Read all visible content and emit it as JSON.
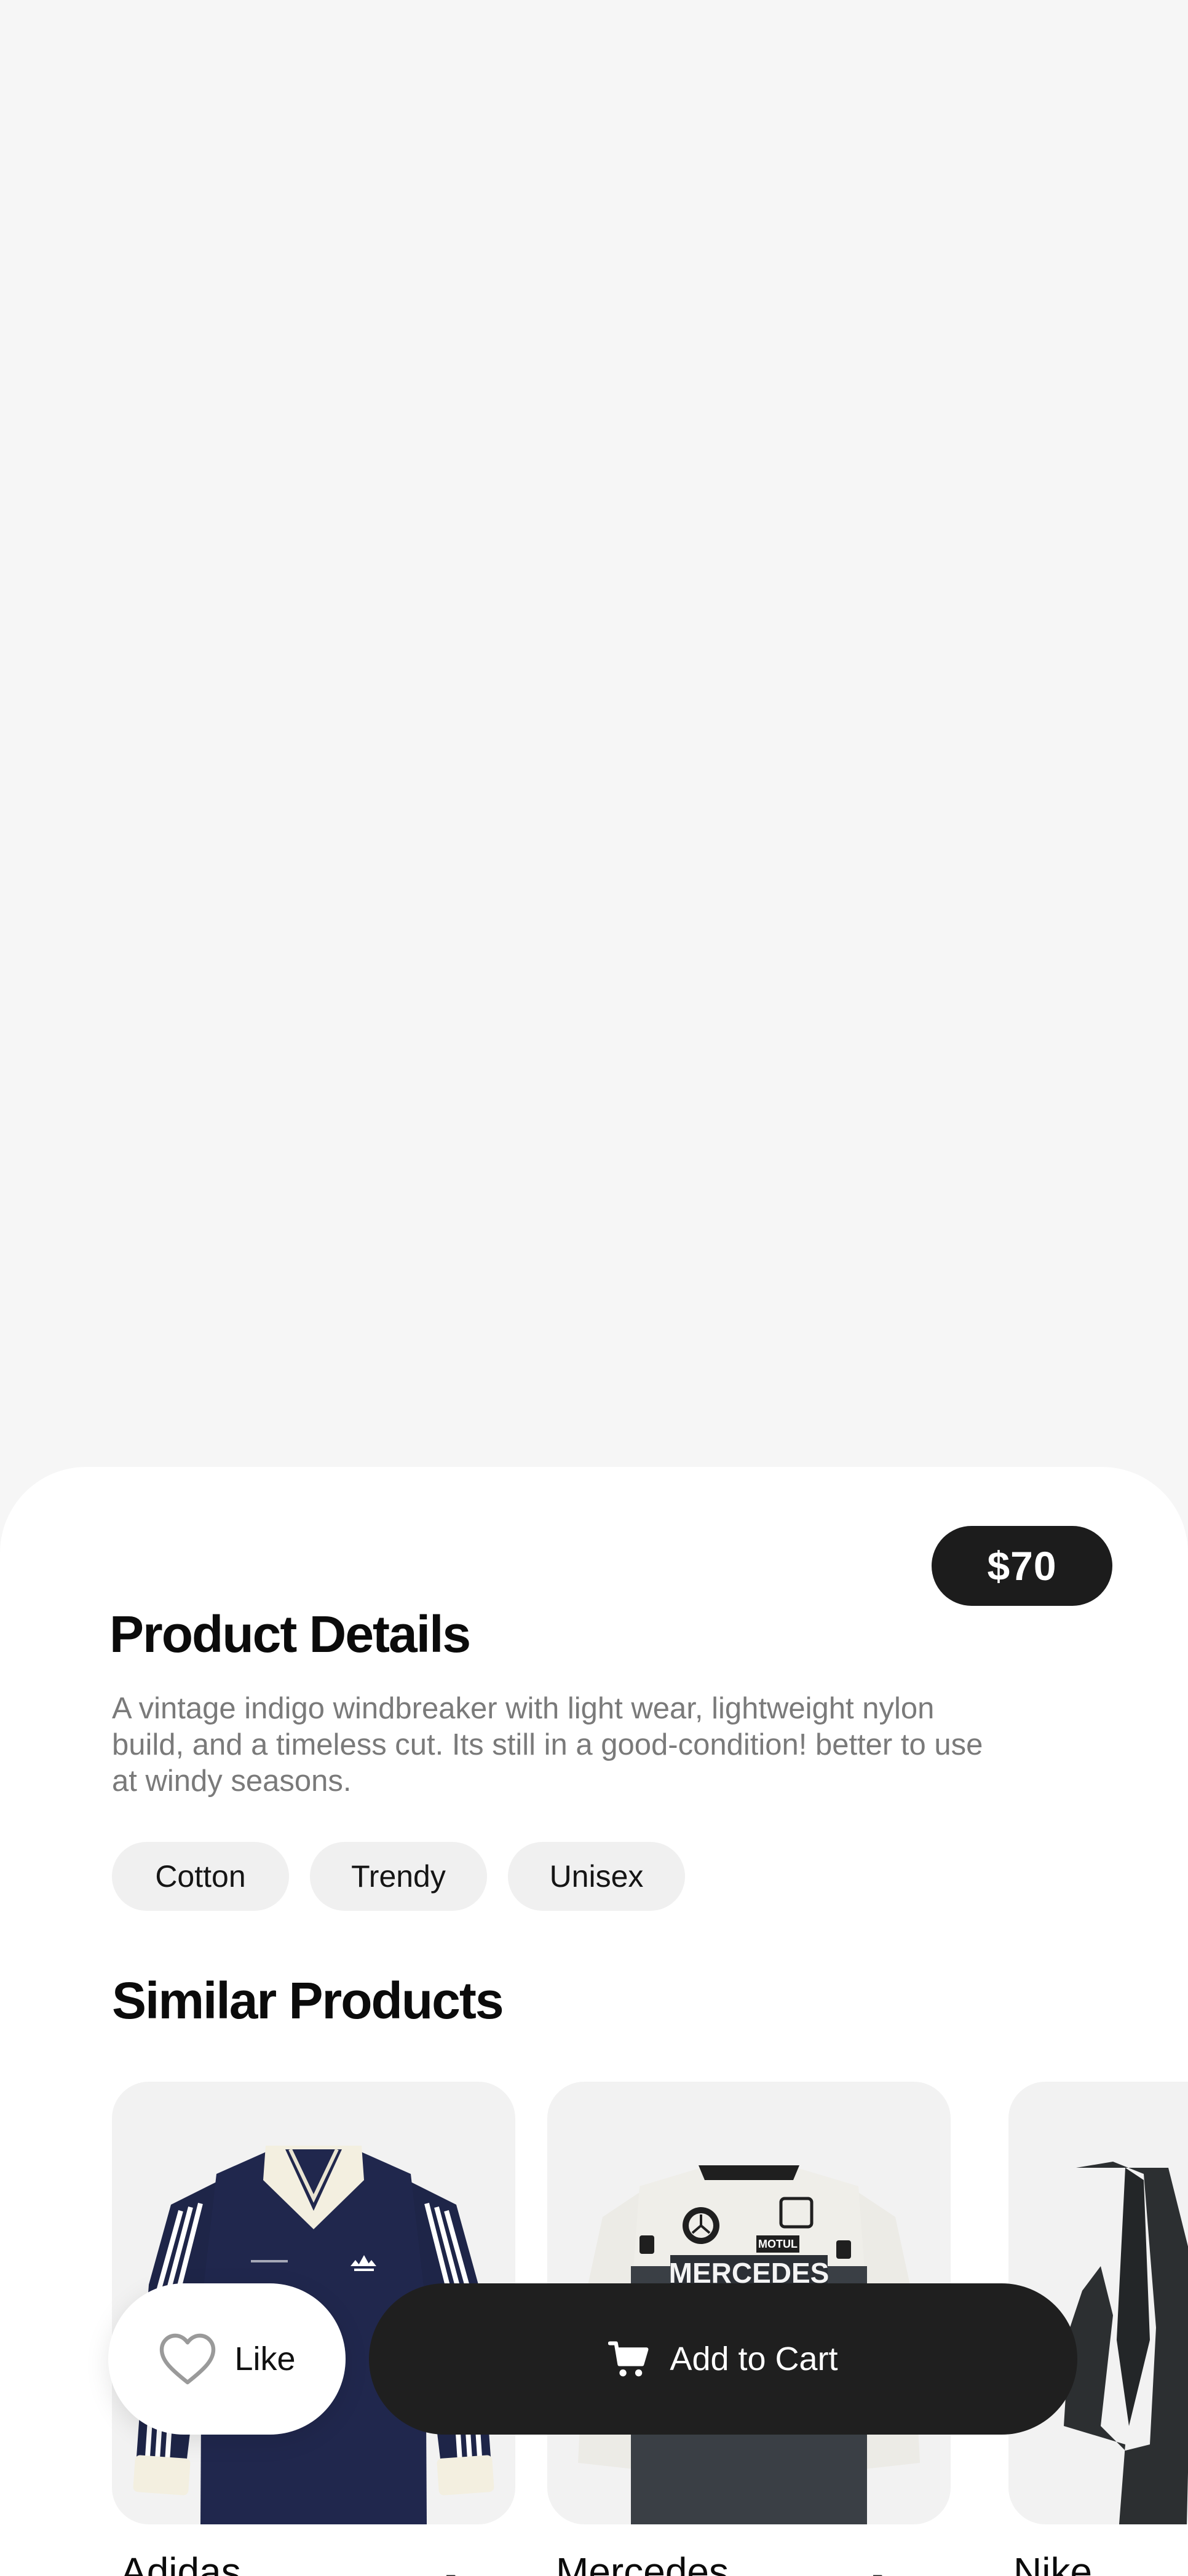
{
  "product": {
    "price": "$70",
    "details_title": "Product Details",
    "description": "A vintage indigo windbreaker with light wear, lightweight nylon build, and a timeless cut. Its still in a good-condition! better to use at windy seasons.",
    "tags": [
      "Cotton",
      "Trendy",
      "Unisex"
    ]
  },
  "similar": {
    "title": "Similar Products",
    "items": [
      {
        "name": "Adidas",
        "image_icon": "jersey-shirt-icon",
        "arrow": "↗"
      },
      {
        "name": "Mercedes",
        "image_icon": "racing-jacket-icon",
        "arrow": "↗"
      },
      {
        "name": "Nike",
        "image_icon": "dark-jacket-icon"
      }
    ],
    "mercedes_print": "MERCEDES",
    "motul_print": "MOTUL"
  },
  "actions": {
    "like_label": "Like",
    "cart_label": "Add to Cart"
  },
  "colors": {
    "accent_dark": "#1c1c1c",
    "background": "#f6f6f6",
    "navy": "#1e2548"
  }
}
